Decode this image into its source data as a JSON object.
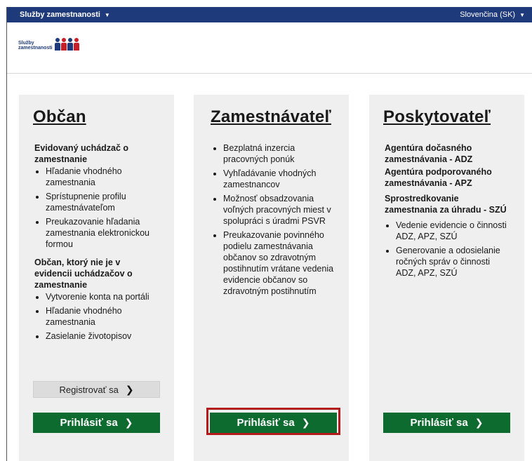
{
  "topbar": {
    "site_menu": "Služby zamestnanosti",
    "language": "Slovenčina (SK)"
  },
  "logo": {
    "text_line1": "Služby",
    "text_line2": "zamestnanosti"
  },
  "cards": [
    {
      "title": "Občan",
      "groups": [
        {
          "title": "Evidovaný uchádzač o zamestnanie",
          "items": [
            "Hľadanie vhodného zamestnania",
            "Sprístupnenie profilu zamestnávateľom",
            "Preukazovanie hľadania zamestnania elektronickou formou"
          ]
        },
        {
          "title": "Občan, ktorý nie je v evidencii uchádzačov o zamestnanie",
          "items": [
            "Vytvorenie konta na portáli",
            "Hľadanie vhodného zamestnania",
            "Zasielanie životopisov"
          ]
        }
      ],
      "register_label": "Registrovať sa",
      "login_label": "Prihlásiť sa"
    },
    {
      "title": "Zamestnávateľ",
      "items": [
        "Bezplatná inzercia pracovných ponúk",
        "Vyhľadávanie vhodných zamestnancov",
        "Možnosť obsadzovania voľných pracovných miest v spolupráci s úradmi PSVR",
        "Preukazovanie povinného podielu zamestnávania občanov so zdravotným postihnutím vrátane vedenia evidencie občanov so zdravotným postihnutím"
      ],
      "login_label": "Prihlásiť sa"
    },
    {
      "title": "Poskytovateľ",
      "headings": [
        "Agentúra dočasného zamestnávania - ADZ",
        "Agentúra podporovaného zamestnávania - APZ",
        "Sprostredkovanie zamestnania za úhradu - SZÚ"
      ],
      "items": [
        "Vedenie evidencie o činnosti ADZ, APZ, SZÚ",
        "Generovanie a odosielanie ročných správ o činnosti ADZ, APZ, SZÚ"
      ],
      "login_label": "Prihlásiť sa"
    }
  ],
  "icons": {
    "caret": "caret-down-icon",
    "chevron": "chevron-right-icon"
  },
  "colors": {
    "topbar": "#1f3a7a",
    "login_button": "#0e6b2f",
    "highlight": "#b21b1b",
    "card_bg": "#efefef"
  }
}
